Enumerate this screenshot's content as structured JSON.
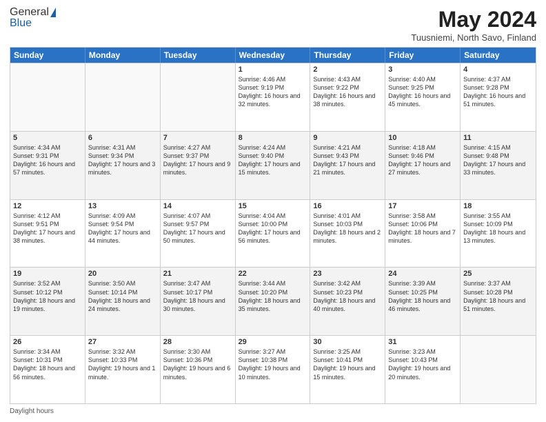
{
  "logo": {
    "line1": "General",
    "line2": "Blue"
  },
  "title": {
    "month_year": "May 2024",
    "location": "Tuusniemi, North Savo, Finland"
  },
  "days_of_week": [
    "Sunday",
    "Monday",
    "Tuesday",
    "Wednesday",
    "Thursday",
    "Friday",
    "Saturday"
  ],
  "footer_text": "Daylight hours",
  "weeks": [
    [
      {
        "day": "",
        "info": ""
      },
      {
        "day": "",
        "info": ""
      },
      {
        "day": "",
        "info": ""
      },
      {
        "day": "1",
        "info": "Sunrise: 4:46 AM\nSunset: 9:19 PM\nDaylight: 16 hours\nand 32 minutes."
      },
      {
        "day": "2",
        "info": "Sunrise: 4:43 AM\nSunset: 9:22 PM\nDaylight: 16 hours\nand 38 minutes."
      },
      {
        "day": "3",
        "info": "Sunrise: 4:40 AM\nSunset: 9:25 PM\nDaylight: 16 hours\nand 45 minutes."
      },
      {
        "day": "4",
        "info": "Sunrise: 4:37 AM\nSunset: 9:28 PM\nDaylight: 16 hours\nand 51 minutes."
      }
    ],
    [
      {
        "day": "5",
        "info": "Sunrise: 4:34 AM\nSunset: 9:31 PM\nDaylight: 16 hours\nand 57 minutes."
      },
      {
        "day": "6",
        "info": "Sunrise: 4:31 AM\nSunset: 9:34 PM\nDaylight: 17 hours\nand 3 minutes."
      },
      {
        "day": "7",
        "info": "Sunrise: 4:27 AM\nSunset: 9:37 PM\nDaylight: 17 hours\nand 9 minutes."
      },
      {
        "day": "8",
        "info": "Sunrise: 4:24 AM\nSunset: 9:40 PM\nDaylight: 17 hours\nand 15 minutes."
      },
      {
        "day": "9",
        "info": "Sunrise: 4:21 AM\nSunset: 9:43 PM\nDaylight: 17 hours\nand 21 minutes."
      },
      {
        "day": "10",
        "info": "Sunrise: 4:18 AM\nSunset: 9:46 PM\nDaylight: 17 hours\nand 27 minutes."
      },
      {
        "day": "11",
        "info": "Sunrise: 4:15 AM\nSunset: 9:48 PM\nDaylight: 17 hours\nand 33 minutes."
      }
    ],
    [
      {
        "day": "12",
        "info": "Sunrise: 4:12 AM\nSunset: 9:51 PM\nDaylight: 17 hours\nand 38 minutes."
      },
      {
        "day": "13",
        "info": "Sunrise: 4:09 AM\nSunset: 9:54 PM\nDaylight: 17 hours\nand 44 minutes."
      },
      {
        "day": "14",
        "info": "Sunrise: 4:07 AM\nSunset: 9:57 PM\nDaylight: 17 hours\nand 50 minutes."
      },
      {
        "day": "15",
        "info": "Sunrise: 4:04 AM\nSunset: 10:00 PM\nDaylight: 17 hours\nand 56 minutes."
      },
      {
        "day": "16",
        "info": "Sunrise: 4:01 AM\nSunset: 10:03 PM\nDaylight: 18 hours\nand 2 minutes."
      },
      {
        "day": "17",
        "info": "Sunrise: 3:58 AM\nSunset: 10:06 PM\nDaylight: 18 hours\nand 7 minutes."
      },
      {
        "day": "18",
        "info": "Sunrise: 3:55 AM\nSunset: 10:09 PM\nDaylight: 18 hours\nand 13 minutes."
      }
    ],
    [
      {
        "day": "19",
        "info": "Sunrise: 3:52 AM\nSunset: 10:12 PM\nDaylight: 18 hours\nand 19 minutes."
      },
      {
        "day": "20",
        "info": "Sunrise: 3:50 AM\nSunset: 10:14 PM\nDaylight: 18 hours\nand 24 minutes."
      },
      {
        "day": "21",
        "info": "Sunrise: 3:47 AM\nSunset: 10:17 PM\nDaylight: 18 hours\nand 30 minutes."
      },
      {
        "day": "22",
        "info": "Sunrise: 3:44 AM\nSunset: 10:20 PM\nDaylight: 18 hours\nand 35 minutes."
      },
      {
        "day": "23",
        "info": "Sunrise: 3:42 AM\nSunset: 10:23 PM\nDaylight: 18 hours\nand 40 minutes."
      },
      {
        "day": "24",
        "info": "Sunrise: 3:39 AM\nSunset: 10:25 PM\nDaylight: 18 hours\nand 46 minutes."
      },
      {
        "day": "25",
        "info": "Sunrise: 3:37 AM\nSunset: 10:28 PM\nDaylight: 18 hours\nand 51 minutes."
      }
    ],
    [
      {
        "day": "26",
        "info": "Sunrise: 3:34 AM\nSunset: 10:31 PM\nDaylight: 18 hours\nand 56 minutes."
      },
      {
        "day": "27",
        "info": "Sunrise: 3:32 AM\nSunset: 10:33 PM\nDaylight: 19 hours\nand 1 minute."
      },
      {
        "day": "28",
        "info": "Sunrise: 3:30 AM\nSunset: 10:36 PM\nDaylight: 19 hours\nand 6 minutes."
      },
      {
        "day": "29",
        "info": "Sunrise: 3:27 AM\nSunset: 10:38 PM\nDaylight: 19 hours\nand 10 minutes."
      },
      {
        "day": "30",
        "info": "Sunrise: 3:25 AM\nSunset: 10:41 PM\nDaylight: 19 hours\nand 15 minutes."
      },
      {
        "day": "31",
        "info": "Sunrise: 3:23 AM\nSunset: 10:43 PM\nDaylight: 19 hours\nand 20 minutes."
      },
      {
        "day": "",
        "info": ""
      }
    ]
  ]
}
